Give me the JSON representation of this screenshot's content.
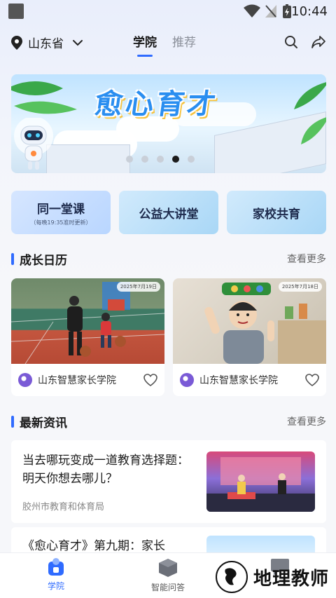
{
  "status_bar": {
    "time": "10:44"
  },
  "header": {
    "location": "山东省",
    "tabs": [
      {
        "label": "学院",
        "active": true
      },
      {
        "label": "推荐",
        "active": false
      }
    ]
  },
  "banner": {
    "title": "愈心育才",
    "slides_total": 5,
    "active_slide": 4
  },
  "quick_buttons": [
    {
      "label": "同一堂课",
      "sub": "（每晚19:35准时更新）"
    },
    {
      "label": "公益大讲堂",
      "sub": ""
    },
    {
      "label": "家校共育",
      "sub": ""
    }
  ],
  "calendar": {
    "title": "成长日历",
    "more": "查看更多",
    "cards": [
      {
        "date": "2025年7月19日",
        "source": "山东智慧家长学院"
      },
      {
        "date": "2025年7月18日",
        "source": "山东智慧家长学院"
      }
    ]
  },
  "news": {
    "title": "最新资讯",
    "more": "查看更多",
    "items": [
      {
        "headline": "当去哪玩变成一道教育选择题：明天你想去哪儿？",
        "source": "胶州市教育和体育局"
      },
      {
        "headline": "《愈心育才》第九期：家长"
      }
    ]
  },
  "bottom_nav": [
    {
      "label": "学院",
      "active": true
    },
    {
      "label": "智能问答",
      "active": false
    }
  ],
  "watermark": {
    "text": "地理教师"
  },
  "colors": {
    "accent": "#2f6bff"
  }
}
